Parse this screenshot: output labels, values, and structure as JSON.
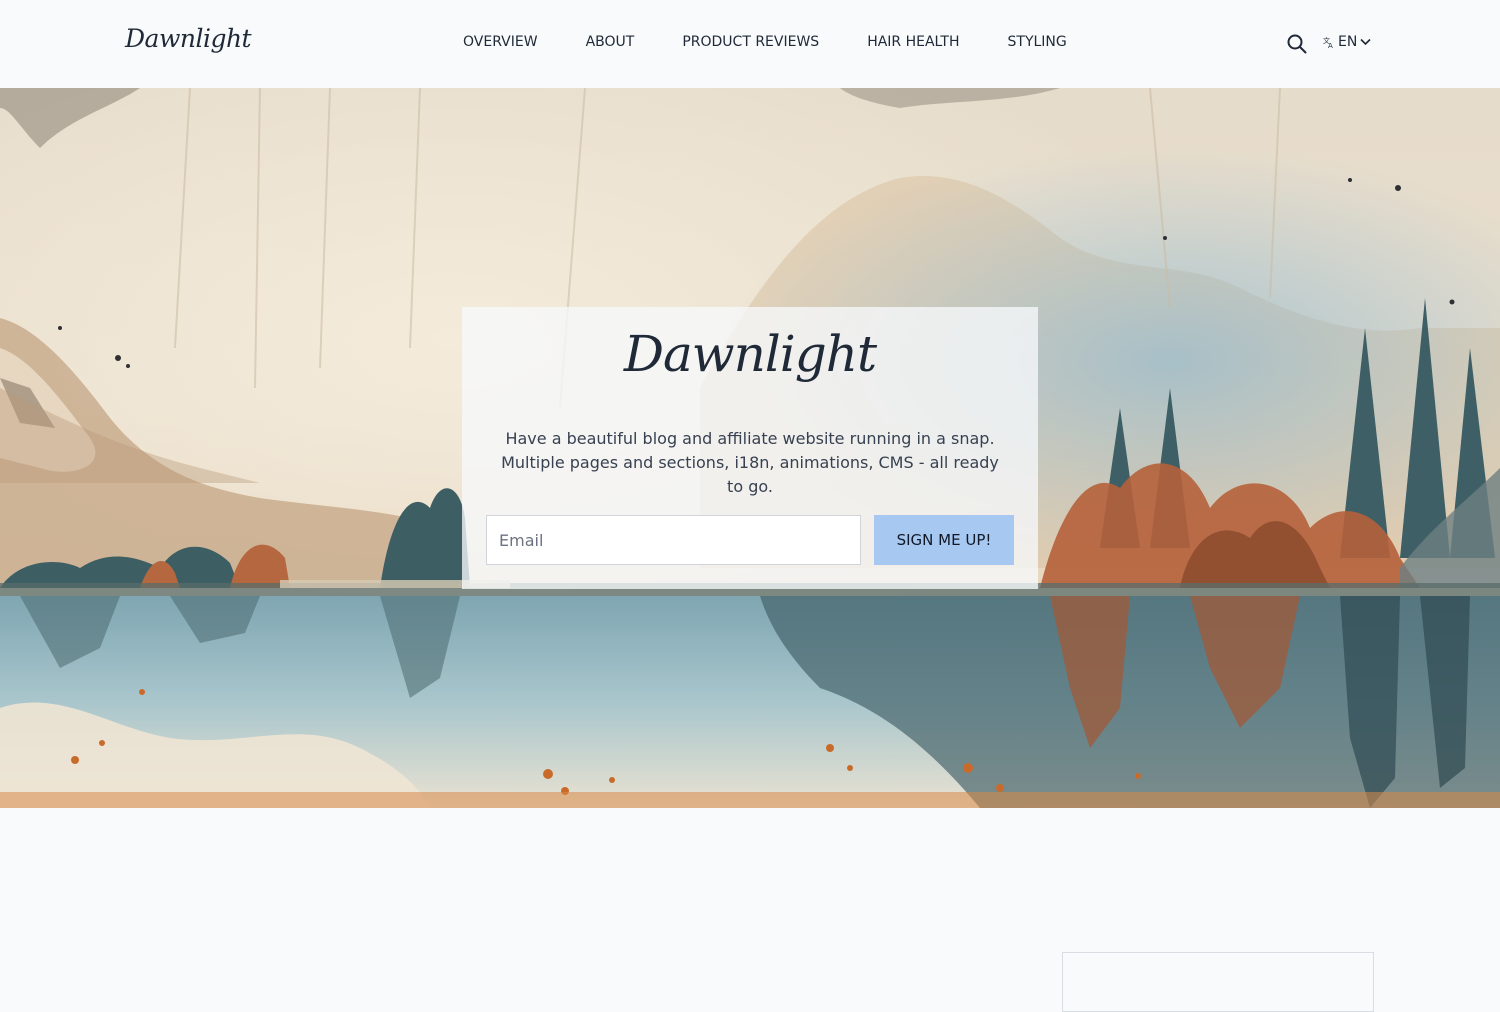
{
  "header": {
    "logo": "Dawnlight",
    "nav": [
      {
        "label": "OVERVIEW"
      },
      {
        "label": "ABOUT"
      },
      {
        "label": "PRODUCT REVIEWS"
      },
      {
        "label": "HAIR HEALTH"
      },
      {
        "label": "STYLING"
      }
    ],
    "search_icon": "search-icon",
    "language": {
      "icon": "translate-icon",
      "label": "EN",
      "chevron": "chevron-down-icon"
    }
  },
  "hero": {
    "title": "Dawnlight",
    "description": "Have a beautiful blog and affiliate website running in a snap. Multiple pages and sections, i18n, animations, CMS - all ready to go.",
    "email_placeholder": "Email",
    "button_label": "SIGN ME UP!",
    "button_color": "#a7c8f0"
  }
}
